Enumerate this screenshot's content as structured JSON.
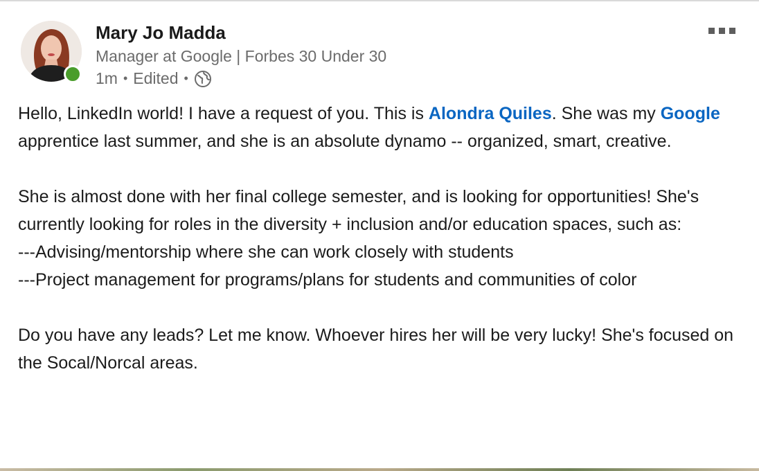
{
  "author": {
    "name": "Mary Jo Madda",
    "headline": "Manager at Google | Forbes 30 Under 30",
    "time": "1m",
    "edited": "Edited",
    "separator": "•",
    "visibility_icon": "globe-icon",
    "status_color": "#4a9d2b"
  },
  "post": {
    "p1_a": "Hello, LinkedIn world! I have a request of you. This is ",
    "mention1": "Alondra Quiles",
    "p1_b": ". She was my ",
    "mention2": "Google",
    "p1_c": " apprentice last summer, and she is an absolute dynamo -- organized, smart, creative.",
    "p2_line1": "She is almost done with her final college semester, and is looking for opportunities! She's currently looking for roles in the diversity + inclusion and/or education spaces, such as:",
    "p2_line2": "---Advising/mentorship where she can work closely with students",
    "p2_line3": "---Project management for programs/plans for students and communities of color",
    "p3": "Do you have any leads? Let me know. Whoever hires her will be very lucky! She's focused on the Socal/Norcal areas."
  },
  "colors": {
    "mention": "#0a66c2",
    "secondary_text": "#6b6b6b"
  }
}
